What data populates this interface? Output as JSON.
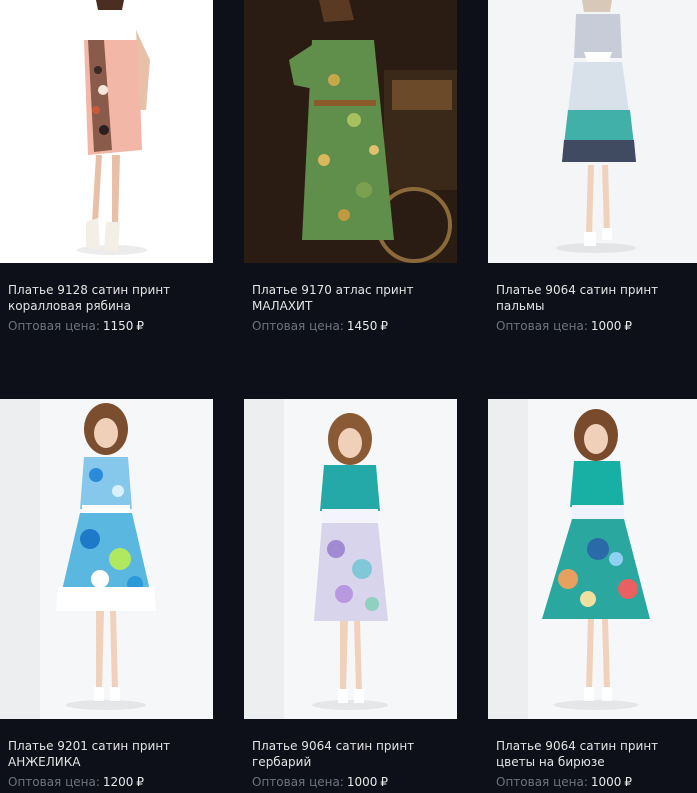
{
  "products": [
    {
      "name": "Платье 9128 сатин принт коралловая рябина",
      "price_label": "Оптовая цена:",
      "price": "1150",
      "currency": "₽",
      "image": "dress-coral-print-photo"
    },
    {
      "name": "Платье 9170 атлас принт МАЛАХИТ",
      "price_label": "Оптовая цена:",
      "price": "1450",
      "currency": "₽",
      "image": "dress-green-floral-photo"
    },
    {
      "name": "Платье 9064 сатин принт пальмы",
      "price_label": "Оптовая цена:",
      "price": "1000",
      "currency": "₽",
      "image": "dress-palms-print-photo"
    },
    {
      "name": "Платье 9201 сатин принт АНЖЕЛИКА",
      "price_label": "Оптовая цена:",
      "price": "1200",
      "currency": "₽",
      "image": "dress-blue-floral-photo"
    },
    {
      "name": "Платье 9064 сатин принт гербарий",
      "price_label": "Оптовая цена:",
      "price": "1000",
      "currency": "₽",
      "image": "dress-herbarium-photo"
    },
    {
      "name": "Платье 9064 сатин принт цветы на бирюзе",
      "price_label": "Оптовая цена:",
      "price": "1000",
      "currency": "₽",
      "image": "dress-turquoise-flowers-photo"
    }
  ]
}
